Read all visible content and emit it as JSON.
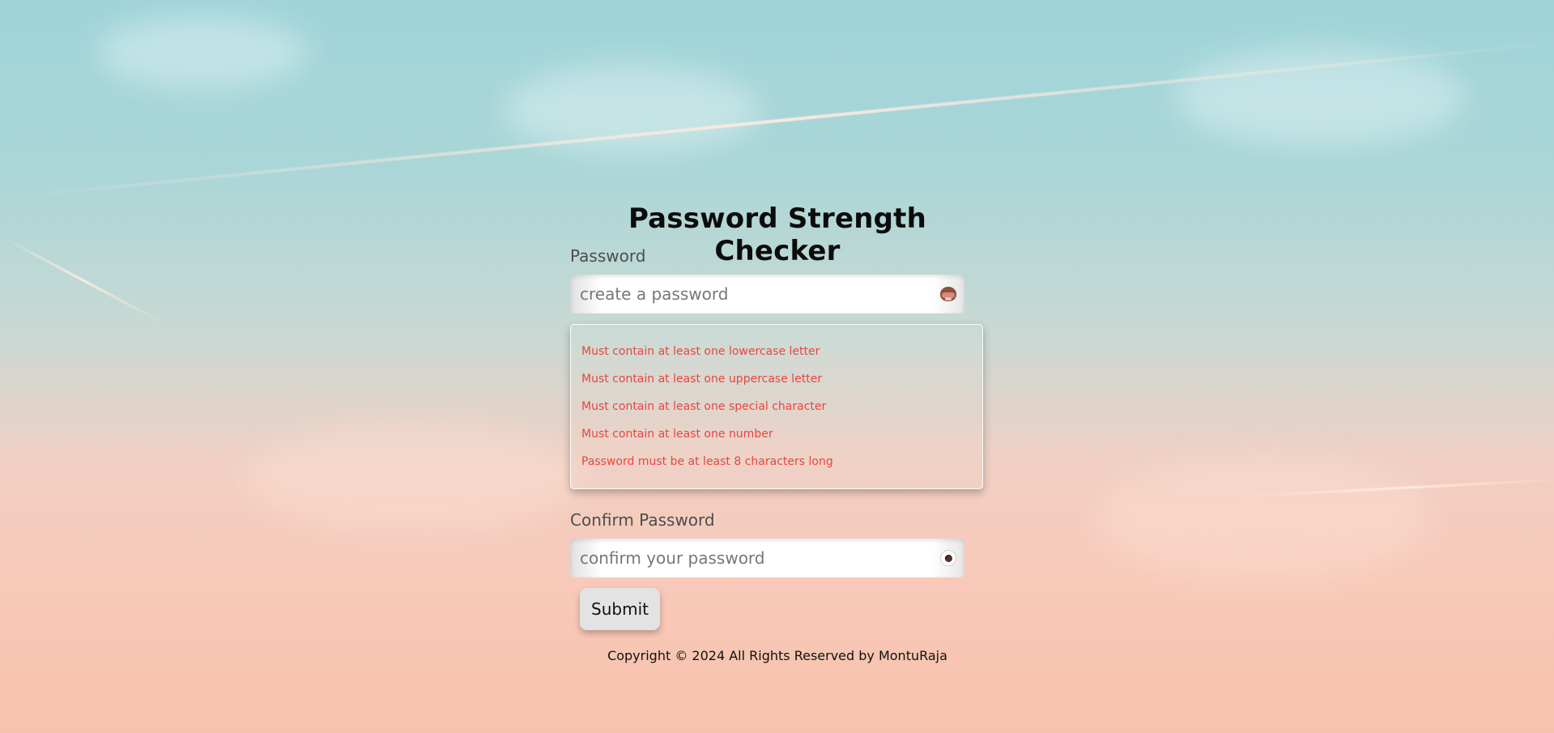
{
  "page": {
    "title": "Password Strength Checker"
  },
  "password": {
    "label": "Password",
    "placeholder": "create a password",
    "value": "",
    "toggle_icon": "see-no-evil-monkey-icon"
  },
  "requirements": {
    "items": [
      "Must contain at least one lowercase letter",
      "Must contain at least one uppercase letter",
      "Must contain at least one special character",
      "Must contain at least one number",
      "Password must be at least 8 characters long"
    ],
    "color": "#e8463f"
  },
  "confirm": {
    "label": "Confirm Password",
    "placeholder": "confirm your password",
    "value": "",
    "toggle_icon": "eye-icon"
  },
  "submit": {
    "label": "Submit"
  },
  "footer": {
    "text": "Copyright © 2024 All Rights Reserved by MontuRaja"
  },
  "colors": {
    "title": "#0c0c0c",
    "label": "#4d4d4d",
    "button_bg": "#e3e3e3"
  }
}
